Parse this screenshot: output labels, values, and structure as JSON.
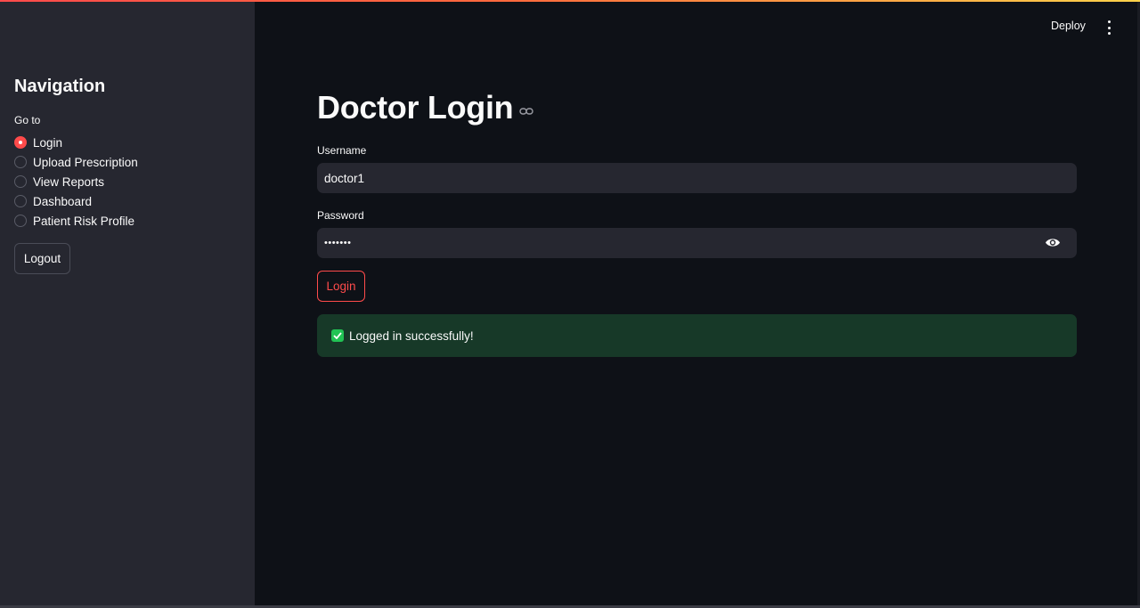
{
  "app": {
    "accent_color": "#ff4b4b",
    "background_color": "#0e1117",
    "sidebar_color": "#262730"
  },
  "header": {
    "deploy_label": "Deploy",
    "menu_icon": "kebab-menu-icon"
  },
  "sidebar": {
    "title": "Navigation",
    "radio_group_label": "Go to",
    "options": [
      {
        "label": "Login",
        "selected": true
      },
      {
        "label": "Upload Prescription",
        "selected": false
      },
      {
        "label": "View Reports",
        "selected": false
      },
      {
        "label": "Dashboard",
        "selected": false
      },
      {
        "label": "Patient Risk Profile",
        "selected": false
      }
    ],
    "logout_label": "Logout"
  },
  "main": {
    "title": "Doctor Login",
    "title_icon": "link-icon",
    "username": {
      "label": "Username",
      "value": "doctor1"
    },
    "password": {
      "label": "Password",
      "value": "•••••••",
      "toggle_icon": "eye-icon"
    },
    "login_label": "Login",
    "alert": {
      "type": "success",
      "icon": "check-icon",
      "message": "Logged in successfully!",
      "color": "#173928"
    }
  }
}
